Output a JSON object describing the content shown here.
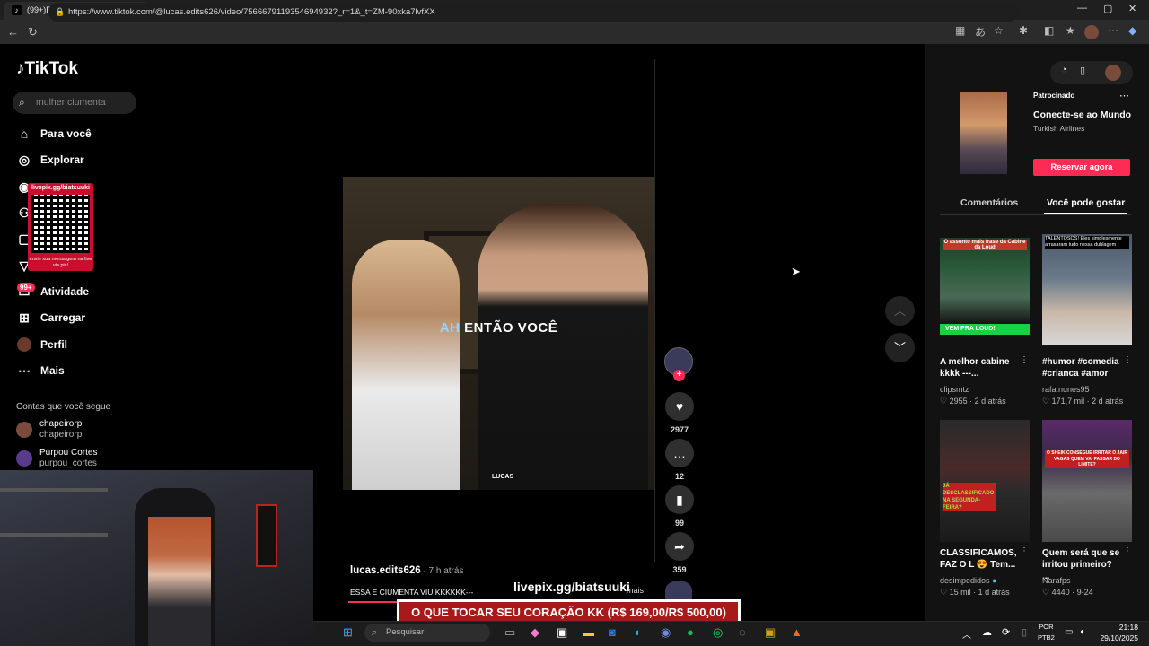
{
  "browser": {
    "tab_title": "(99+)ESSA E CIUMENTA VIU KKKK",
    "tab_favicon": "♪",
    "url": "https://www.tiktok.com/@lucas.edits626/video/7566679119354694932?_r=1&_t=ZM-90xka7lvfXX"
  },
  "tiktok": {
    "logo": "TikTok",
    "search_placeholder": "mulher ciumenta",
    "nav": [
      {
        "label": "Para você",
        "icon": "home-icon"
      },
      {
        "label": "Explorar",
        "icon": "compass-icon"
      },
      {
        "label": "Atividade",
        "icon": "inbox-icon"
      },
      {
        "label": "Carregar",
        "icon": "upload-icon"
      },
      {
        "label": "Perfil",
        "icon": "profile-icon"
      },
      {
        "label": "Mais",
        "icon": "more-icon"
      }
    ],
    "activity_badge": "99+",
    "qr": {
      "top": "livepix.gg/biatsuuki",
      "bottom": "envie sua mensagem na live via pix!"
    },
    "following_header": "Contas que você segue",
    "following": [
      {
        "name": "chapeirorp",
        "handle": "chapeirorp"
      },
      {
        "name": "Purpou Cortes",
        "handle": "purpou_cortes"
      }
    ]
  },
  "video": {
    "caption_prefix": "AH",
    "caption_rest": " ENTÃO VOCÊ",
    "watermark": "LUCAS",
    "author": "lucas.edits626",
    "time": " · 7 h atrás",
    "description": "ESSA E CIUMENTA VIU KKKKKK---",
    "more": "mais",
    "progress": 0.42
  },
  "actions": {
    "likes": "2977",
    "comments": "12",
    "saves": "99",
    "shares": "359"
  },
  "stream_overlay": {
    "livepix": "livepix.gg/biatsuuki",
    "banner": "O QUE TOCAR SEU CORAÇÃO KK (R$ 169,00/R$ 500,00)"
  },
  "ad": {
    "tag": "Patrocinado",
    "title": "Conecte-se ao Mundo",
    "sponsor": "Turkish Airlines",
    "cta": "Reservar agora"
  },
  "tabs": {
    "comments": "Comentários",
    "suggested": "Você pode gostar"
  },
  "cards": [
    {
      "title": "A melhor cabine kkkk ---...",
      "author": "clipsmtz",
      "likes": "♡ 2955",
      "age": "· 2 d atrás",
      "thumb_text": "O assunto mais frase da Cabine da Loud",
      "thumb_strip": "VEM PRA LOUD!"
    },
    {
      "title": "#humor #comedia #crianca #amor",
      "author": "rafa.nunes95",
      "likes": "♡ 171,7 mil",
      "age": "· 2 d atrás",
      "thumb_text": "TALENTOSOS! Eles simplesmente arrasaram tudo nessa dublagem"
    },
    {
      "title": "CLASSIFICAMOS, FAZ O L 😍 Tem...",
      "author": "desimpedidos",
      "likes": "♡ 15 mil",
      "age": "· 1 d atrás",
      "thumb_text": "JÁ DESCLASSIFICADO NA SEGUNDA-FEIRA?"
    },
    {
      "title": "Quem será que se irritou primeiro? ...",
      "author": "Narafps",
      "likes": "♡ 4440",
      "age": "· 9-24",
      "thumb_text": "O SHEIK CONSEGUE IRRITAR O JAIR VAGAS QUEM VAI PASSAR DO LIMITE?"
    }
  ],
  "taskbar": {
    "search": "Pesquisar",
    "lang1": "POR",
    "lang2": "PTB2",
    "time": "21:18",
    "date": "29/10/2025"
  },
  "colors": {
    "accent": "#fe2c55",
    "banner": "#a81a1a"
  }
}
